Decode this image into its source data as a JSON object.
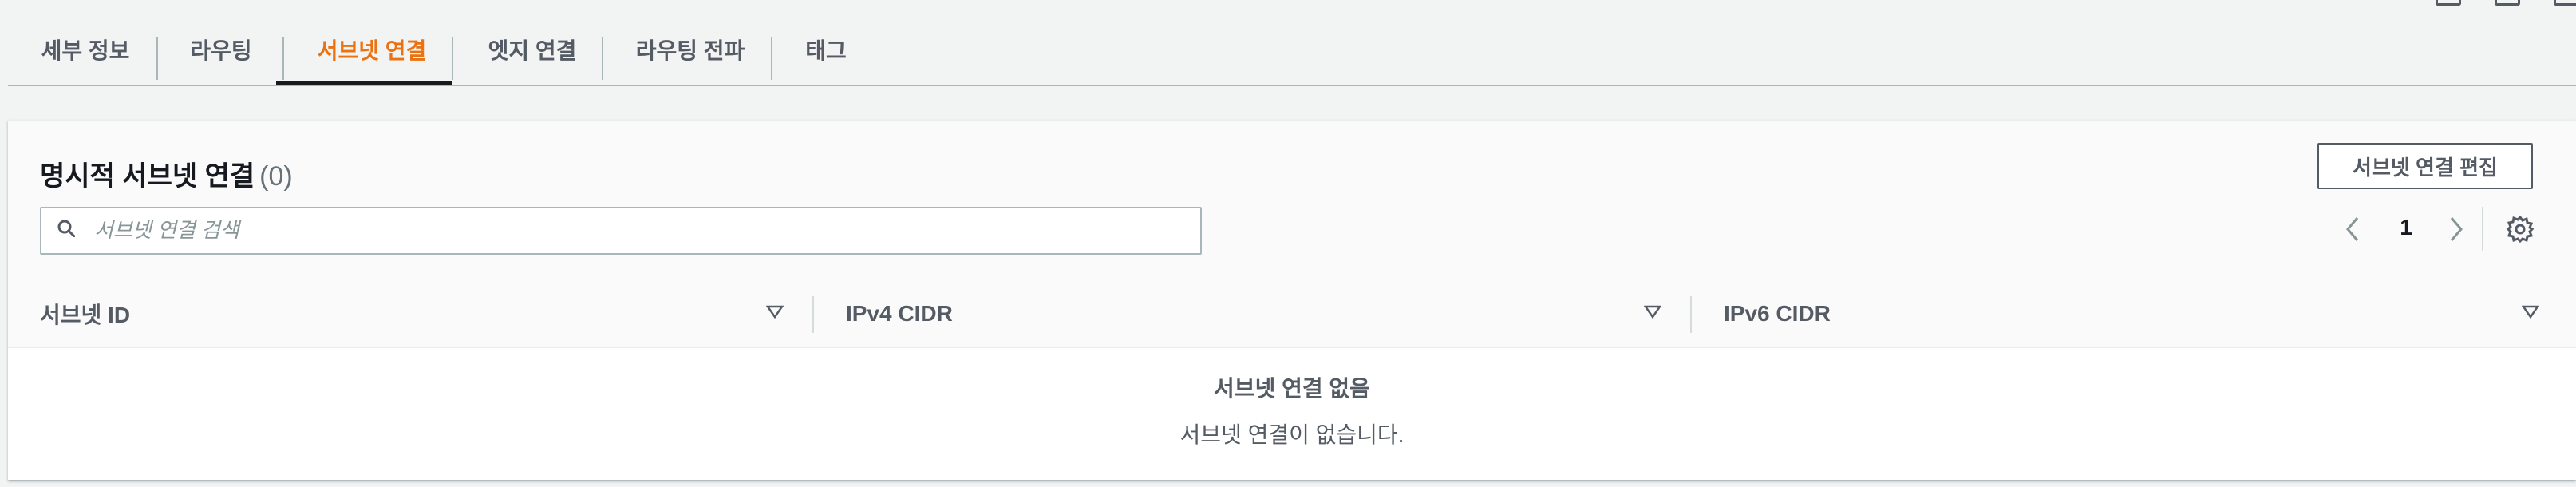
{
  "tabs": [
    {
      "label": "세부 정보",
      "active": false
    },
    {
      "label": "라우팅",
      "active": false
    },
    {
      "label": "서브넷 연결",
      "active": true
    },
    {
      "label": "엣지 연결",
      "active": false
    },
    {
      "label": "라우팅 전파",
      "active": false
    },
    {
      "label": "태그",
      "active": false
    }
  ],
  "panel": {
    "title": "명시적 서브넷 연결",
    "count": "(0)",
    "edit_button": "서브넷 연결 편집",
    "search_placeholder": "서브넷 연결 검색",
    "pagination": {
      "current_page": "1"
    }
  },
  "table": {
    "columns": [
      "서브넷 ID",
      "IPv4 CIDR",
      "IPv6 CIDR"
    ],
    "empty_title": "서브넷 연결 없음",
    "empty_description": "서브넷 연결이 없습니다."
  },
  "colors": {
    "accent": "#ec7211",
    "text": "#16191f",
    "muted": "#545b64"
  },
  "icons": [
    "search-icon",
    "chevron-left-icon",
    "chevron-right-icon",
    "gear-icon",
    "sort-caret-icon"
  ]
}
